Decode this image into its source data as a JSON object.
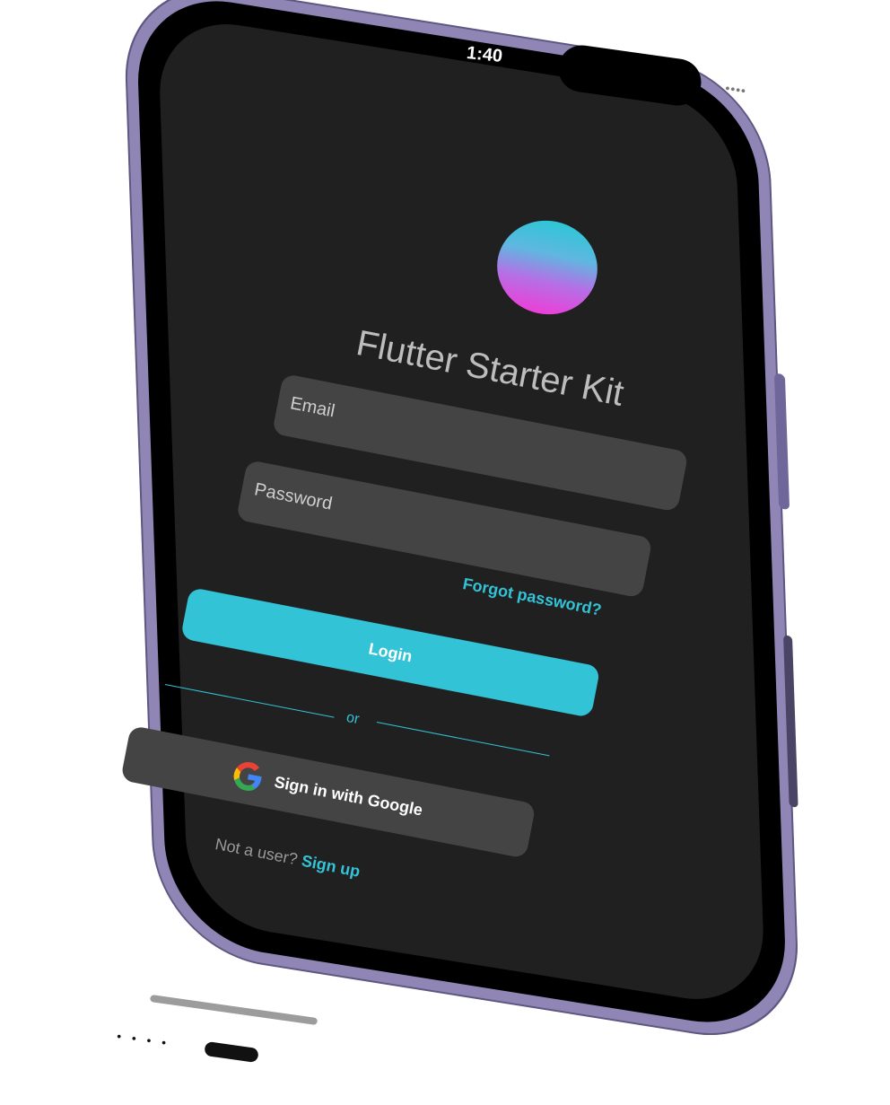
{
  "status_bar": {
    "time": "1:40",
    "signal": "••••"
  },
  "app": {
    "title": "Flutter Starter Kit",
    "email_placeholder": "Email",
    "password_placeholder": "Password",
    "forgot_password": "Forgot password?",
    "login_label": "Login",
    "divider_text": "or",
    "google_label": "Sign in with Google",
    "not_user_text": "Not a user?",
    "signup_link": "Sign up"
  },
  "colors": {
    "accent": "#33c3d6",
    "background": "#202020",
    "field": "#444444",
    "frame": "#8f86b5"
  },
  "icons": {
    "logo": "gradient-circle-logo",
    "google": "google-icon",
    "wifi": "wifi-icon",
    "battery": "battery-icon"
  }
}
